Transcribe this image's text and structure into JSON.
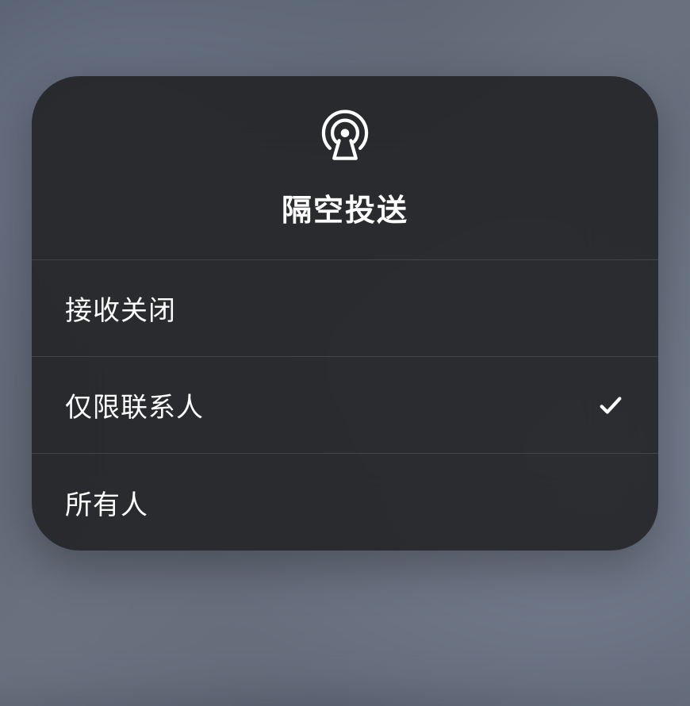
{
  "header": {
    "title": "隔空投送",
    "icon": "airdrop-icon"
  },
  "options": [
    {
      "id": "receiving-off",
      "label": "接收关闭",
      "selected": false
    },
    {
      "id": "contacts-only",
      "label": "仅限联系人",
      "selected": true
    },
    {
      "id": "everyone",
      "label": "所有人",
      "selected": false
    }
  ]
}
